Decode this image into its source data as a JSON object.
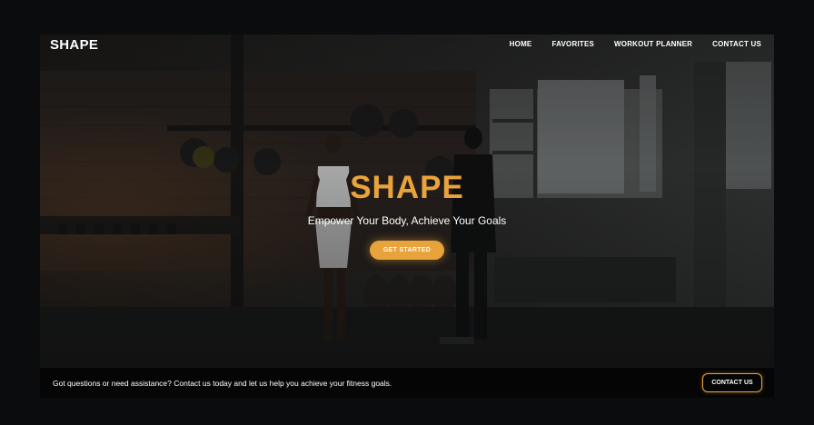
{
  "nav": {
    "logo": "SHAPE",
    "links": [
      "HOME",
      "FAVORITES",
      "WORKOUT PLANNER",
      "CONTACT US"
    ]
  },
  "hero": {
    "title": "SHAPE",
    "subtitle": "Empower Your Body, Achieve Your Goals",
    "cta_label": "GET STARTED",
    "background_image": "gym-photo"
  },
  "footer": {
    "message": "Got questions or need assistance? Contact us today and let us help you achieve your fitness goals.",
    "contact_label": "CONTACT US"
  },
  "colors": {
    "accent": "#e8a33c",
    "background": "#0b0c0d",
    "text": "#ffffff"
  }
}
